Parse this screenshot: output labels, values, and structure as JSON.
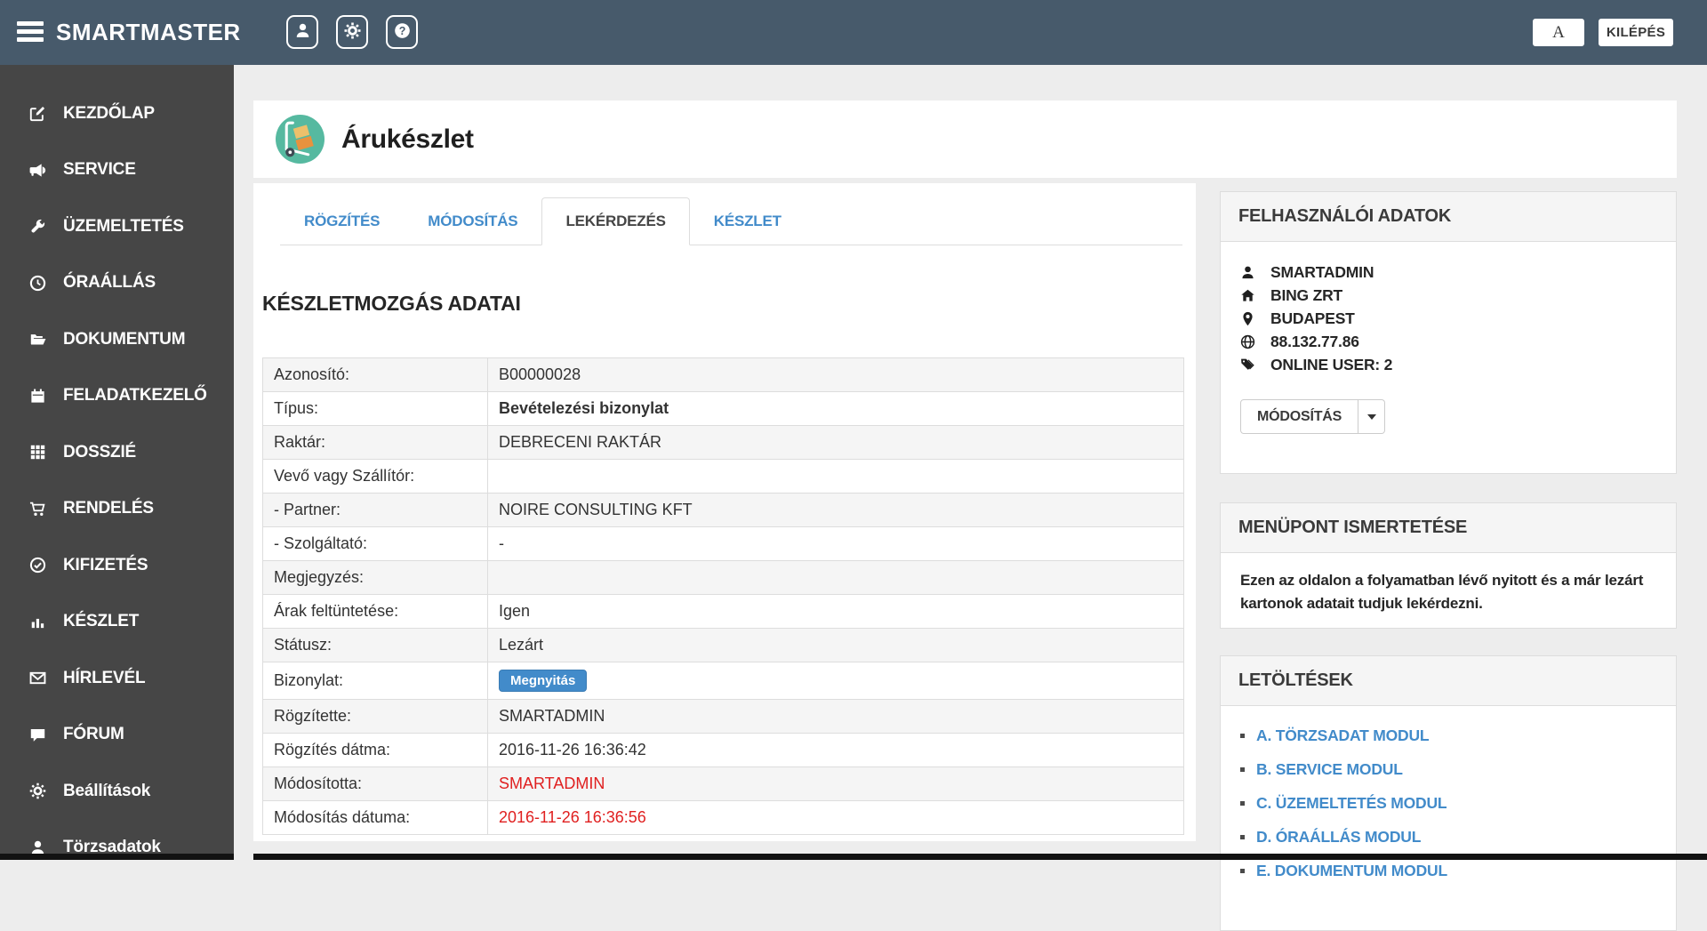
{
  "topbar": {
    "brand": "SMARTMASTER",
    "font_button_label": "A",
    "logout_label": "KILÉPÉS",
    "icons": [
      "user-icon",
      "gear-icon",
      "help-icon"
    ]
  },
  "sidebar": {
    "items": [
      {
        "label": "KEZDŐLAP",
        "icon": "edit-icon"
      },
      {
        "label": "SERVICE",
        "icon": "megaphone-icon"
      },
      {
        "label": "ÜZEMELTETÉS",
        "icon": "wrench-icon"
      },
      {
        "label": "ÓRAÁLLÁS",
        "icon": "clock-icon"
      },
      {
        "label": "DOKUMENTUM",
        "icon": "folder-icon"
      },
      {
        "label": "FELADATKEZELŐ",
        "icon": "calendar-icon"
      },
      {
        "label": "DOSSZIÉ",
        "icon": "grid-icon"
      },
      {
        "label": "RENDELÉS",
        "icon": "cart-icon"
      },
      {
        "label": "KIFIZETÉS",
        "icon": "check-circle-icon"
      },
      {
        "label": "KÉSZLET",
        "icon": "bar-chart-icon"
      },
      {
        "label": "HÍRLEVÉL",
        "icon": "envelope-icon"
      },
      {
        "label": "FÓRUM",
        "icon": "comment-icon"
      },
      {
        "label": "Beállítások",
        "icon": "gear-icon"
      },
      {
        "label": "Törzsadatok",
        "icon": "user-icon"
      }
    ]
  },
  "page": {
    "title": "Árukészlet",
    "title_icon": "hand-truck-icon",
    "tabs": [
      {
        "label": "RÖGZÍTÉS",
        "active": false
      },
      {
        "label": "MÓDOSÍTÁS",
        "active": false
      },
      {
        "label": "LEKÉRDEZÉS",
        "active": true
      },
      {
        "label": "KÉSZLET",
        "active": false
      }
    ],
    "section_title": "KÉSZLETMOZGÁS ADATAI",
    "table": {
      "rows": [
        {
          "label": "Azonosító:",
          "value": "B00000028"
        },
        {
          "label": "Típus:",
          "value": "Bevételezési bizonylat",
          "style": "bold"
        },
        {
          "label": "Raktár:",
          "value": "DEBRECENI RAKTÁR"
        },
        {
          "label": "Vevő vagy Szállítór:",
          "value": ""
        },
        {
          "label": "- Partner:",
          "value": "NOIRE CONSULTING KFT"
        },
        {
          "label": "- Szolgáltató:",
          "value": "-"
        },
        {
          "label": "Megjegyzés:",
          "value": ""
        },
        {
          "label": "Árak feltüntetése:",
          "value": "Igen"
        },
        {
          "label": "Státusz:",
          "value": "Lezárt"
        },
        {
          "label": "Bizonylat:",
          "value": "Megnyitás",
          "style": "button"
        },
        {
          "label": "Rögzítette:",
          "value": "SMARTADMIN"
        },
        {
          "label": "Rögzítés dátma:",
          "value": "2016-11-26 16:36:42"
        },
        {
          "label": "Módosította:",
          "value": "SMARTADMIN",
          "style": "red"
        },
        {
          "label": "Módosítás dátuma:",
          "value": "2016-11-26 16:36:56",
          "style": "red"
        }
      ]
    }
  },
  "user_panel": {
    "title": "FELHASZNÁLÓI ADATOK",
    "items": [
      {
        "icon": "user-icon",
        "value": "SMARTADMIN"
      },
      {
        "icon": "home-icon",
        "value": "BING ZRT"
      },
      {
        "icon": "map-marker-icon",
        "value": "BUDAPEST"
      },
      {
        "icon": "globe-icon",
        "value": "88.132.77.86"
      },
      {
        "icon": "tags-icon",
        "value": "ONLINE USER: 2"
      }
    ],
    "button_label": "MÓDOSÍTÁS"
  },
  "menu_info_panel": {
    "title": "MENÜPONT ISMERTETÉSE",
    "text": "Ezen az oldalon a folyamatban lévő nyitott és a már lezárt kartonok adatait tudjuk lekérdezni."
  },
  "downloads_panel": {
    "title": "LETÖLTÉSEK",
    "links": [
      "A. TÖRZSADAT MODUL",
      "B. SERVICE MODUL",
      "C. ÜZEMELTETÉS MODUL",
      "D. ÓRAÁLLÁS MODUL",
      "E. DOKUMENTUM MODUL"
    ]
  },
  "colors": {
    "topbar": "#475a6b",
    "sidebar": "#464646",
    "link_blue": "#428bca",
    "accent_green": "#56b9a0",
    "danger_red": "#e02020",
    "panel_header_bg": "#f5f5f5",
    "stripe_bg": "#f5f5f5",
    "border": "#dddddd"
  }
}
